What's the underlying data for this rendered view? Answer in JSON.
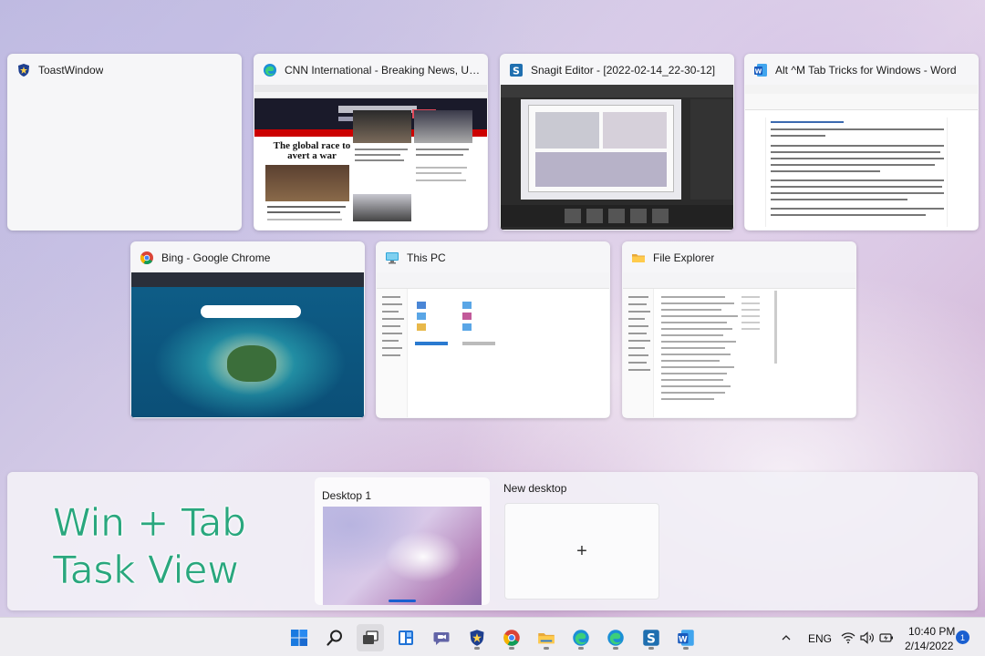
{
  "windows": [
    {
      "title": "ToastWindow",
      "icon": "shield-app-icon"
    },
    {
      "title": "CNN International - Breaking News, US...",
      "icon": "edge-icon",
      "thumb": {
        "headline": "The global race to avert a war"
      }
    },
    {
      "title": "Snagit Editor - [2022-02-14_22-30-12]",
      "icon": "snagit-icon"
    },
    {
      "title": "Alt ^M Tab Tricks for Windows - Word",
      "icon": "word-icon"
    },
    {
      "title": "Bing - Google Chrome",
      "icon": "chrome-icon"
    },
    {
      "title": "This PC",
      "icon": "this-pc-icon"
    },
    {
      "title": "File Explorer",
      "icon": "folder-icon"
    }
  ],
  "overlay": {
    "line1": "Win + Tab",
    "line2": "Task View"
  },
  "desktops": {
    "current": {
      "label": "Desktop 1"
    },
    "new": {
      "label": "New desktop",
      "plus": "+"
    }
  },
  "taskbar": {
    "apps": [
      "start-icon",
      "search-icon",
      "task-view-icon",
      "widgets-icon",
      "teams-chat-icon",
      "shield-app-icon",
      "chrome-icon",
      "file-explorer-icon",
      "edge-icon",
      "edge-icon",
      "snagit-icon",
      "word-icon"
    ],
    "language": "ENG",
    "time": "10:40 PM",
    "date": "2/14/2022",
    "notifications": "1"
  },
  "colors": {
    "accent": "#1a5fd0",
    "overlay_text": "#2aa77e"
  }
}
